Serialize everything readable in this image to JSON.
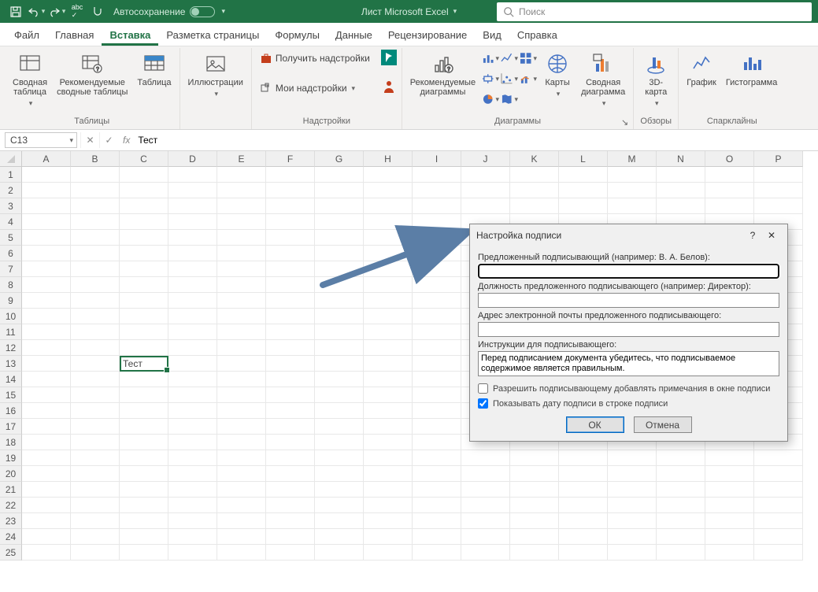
{
  "titlebar": {
    "autosave_label": "Автосохранение",
    "doc_title": "Лист Microsoft Excel",
    "search_placeholder": "Поиск"
  },
  "tabs": [
    "Файл",
    "Главная",
    "Вставка",
    "Разметка страницы",
    "Формулы",
    "Данные",
    "Рецензирование",
    "Вид",
    "Справка"
  ],
  "active_tab_index": 2,
  "ribbon": {
    "groups": {
      "tables": {
        "label": "Таблицы",
        "pivot": "Сводная\nтаблица",
        "recommended_pivot": "Рекомендуемые\nсводные таблицы",
        "table": "Таблица"
      },
      "illustrations": {
        "label": "Иллюстрации"
      },
      "addins": {
        "label": "Надстройки",
        "get": "Получить надстройки",
        "my": "Мои надстройки"
      },
      "charts": {
        "label": "Диаграммы",
        "recommended": "Рекомендуемые\nдиаграммы",
        "maps": "Карты",
        "pivotchart": "Сводная\nдиаграмма"
      },
      "tours": {
        "label": "Обзоры",
        "map3d": "3D-\nкарта"
      },
      "sparklines": {
        "label": "Спарклайны",
        "line": "График",
        "column": "Гистограмма"
      }
    }
  },
  "formula_bar": {
    "name": "C13",
    "value": "Тест",
    "fx": "fx"
  },
  "sheet": {
    "columns": [
      "A",
      "B",
      "C",
      "D",
      "E",
      "F",
      "G",
      "H",
      "I",
      "J",
      "K",
      "L",
      "M",
      "N",
      "O",
      "P"
    ],
    "col_sizes": {
      "default": 62,
      "A": 62,
      "B": 62,
      "C": 62,
      "D": 62,
      "E": 62,
      "F": 62,
      "G": 62,
      "H": 62,
      "I": 62,
      "J": 62,
      "K": 62,
      "L": 62,
      "M": 62,
      "N": 62,
      "O": 62,
      "P": 62
    },
    "selected_cell": "C13",
    "cell_value": "Тест",
    "visible_rows": 25
  },
  "dialog": {
    "title": "Настройка подписи",
    "field1_label": "Предложенный подписывающий (например: В. А. Белов):",
    "field1_value": "",
    "field2_label": "Должность предложенного подписывающего (например: Директор):",
    "field2_value": "",
    "field3_label": "Адрес электронной почты предложенного подписывающего:",
    "field3_value": "",
    "field4_label": "Инструкции для подписывающего:",
    "field4_value": "Перед подписанием документа убедитесь, что подписываемое содержимое является правильным.",
    "check1_label": "Разрешить подписывающему добавлять примечания в окне подписи",
    "check1_checked": false,
    "check2_label": "Показывать дату подписи в строке подписи",
    "check2_checked": true,
    "ok": "ОК",
    "cancel": "Отмена",
    "help": "?",
    "close": "✕"
  }
}
